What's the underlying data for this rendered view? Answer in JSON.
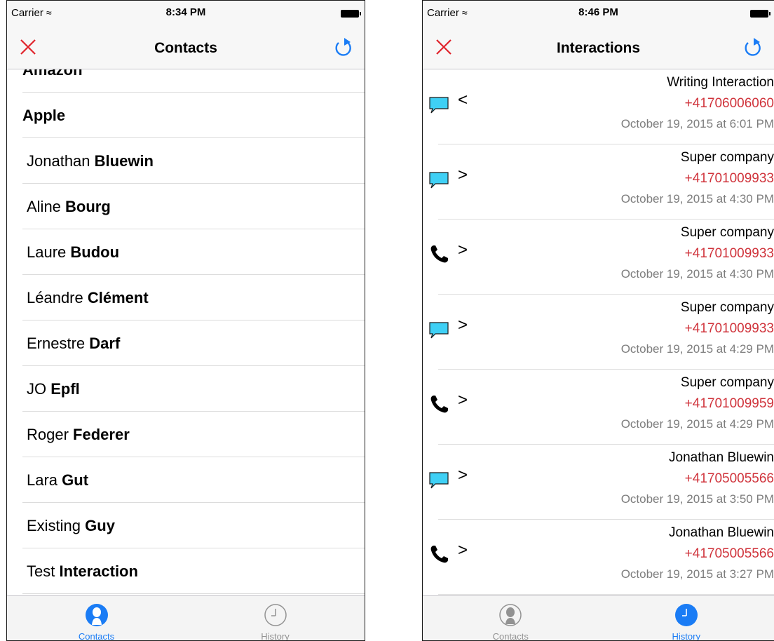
{
  "colors": {
    "accent_blue": "#1a7cf5",
    "close_red": "#e0222a",
    "phone_red": "#d0343c",
    "bubble_cyan": "#3fd0f5",
    "inactive_gray": "#929292"
  },
  "left_screen": {
    "status": {
      "carrier": "Carrier",
      "time": "8:34 PM"
    },
    "nav": {
      "title": "Contacts",
      "left_icon": "close-icon",
      "right_icon": "refresh-icon"
    },
    "contacts": [
      {
        "first": "",
        "last": "Amazon",
        "company": true
      },
      {
        "first": "",
        "last": "Apple",
        "company": true
      },
      {
        "first": "Jonathan ",
        "last": "Bluewin",
        "company": false
      },
      {
        "first": "Aline ",
        "last": "Bourg",
        "company": false
      },
      {
        "first": "Laure ",
        "last": "Budou",
        "company": false
      },
      {
        "first": "Léandre ",
        "last": "Clément",
        "company": false
      },
      {
        "first": "Ernestre ",
        "last": "Darf",
        "company": false
      },
      {
        "first": "JO ",
        "last": "Epfl",
        "company": false
      },
      {
        "first": "Roger ",
        "last": "Federer",
        "company": false
      },
      {
        "first": "Lara ",
        "last": "Gut",
        "company": false
      },
      {
        "first": "Existing ",
        "last": "Guy",
        "company": false
      },
      {
        "first": "Test ",
        "last": "Interaction",
        "company": false
      }
    ],
    "tabs": [
      {
        "label": "Contacts",
        "icon": "person-icon",
        "active": true
      },
      {
        "label": "History",
        "icon": "clock-icon",
        "active": false
      }
    ]
  },
  "right_screen": {
    "status": {
      "carrier": "Carrier",
      "time": "8:46 PM"
    },
    "nav": {
      "title": "Interactions",
      "left_icon": "close-icon",
      "right_icon": "refresh-icon"
    },
    "interactions": [
      {
        "kind": "message",
        "direction": "<",
        "name": "Writing Interaction",
        "phone": "+41706006060",
        "date": "October 19, 2015 at 6:01 PM"
      },
      {
        "kind": "message",
        "direction": ">",
        "name": "Super company",
        "phone": "+41701009933",
        "date": "October 19, 2015 at 4:30 PM"
      },
      {
        "kind": "call",
        "direction": ">",
        "name": "Super company",
        "phone": "+41701009933",
        "date": "October 19, 2015 at 4:30 PM"
      },
      {
        "kind": "message",
        "direction": ">",
        "name": "Super company",
        "phone": "+41701009933",
        "date": "October 19, 2015 at 4:29 PM"
      },
      {
        "kind": "call",
        "direction": ">",
        "name": "Super company",
        "phone": "+41701009959",
        "date": "October 19, 2015 at 4:29 PM"
      },
      {
        "kind": "message",
        "direction": ">",
        "name": "Jonathan Bluewin",
        "phone": "+41705005566",
        "date": "October 19, 2015 at 3:50 PM"
      },
      {
        "kind": "call",
        "direction": ">",
        "name": "Jonathan Bluewin",
        "phone": "+41705005566",
        "date": "October 19, 2015 at 3:27 PM"
      }
    ],
    "tabs": [
      {
        "label": "Contacts",
        "icon": "person-icon",
        "active": false
      },
      {
        "label": "History",
        "icon": "clock-icon",
        "active": true
      }
    ]
  }
}
